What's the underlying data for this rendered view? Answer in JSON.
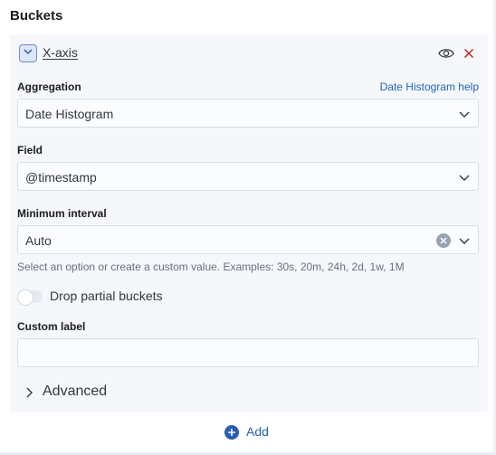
{
  "panel": {
    "title": "Buckets"
  },
  "bucket": {
    "name": "X-axis",
    "aggregation": {
      "label": "Aggregation",
      "help_link": "Date Histogram help",
      "value": "Date Histogram"
    },
    "field": {
      "label": "Field",
      "value": "@timestamp"
    },
    "interval": {
      "label": "Minimum interval",
      "value": "Auto",
      "hint": "Select an option or create a custom value. Examples: 30s, 20m, 24h, 2d, 1w, 1M"
    },
    "drop_partial": {
      "label": "Drop partial buckets",
      "checked": false
    },
    "custom_label": {
      "label": "Custom label",
      "value": ""
    },
    "advanced_label": "Advanced"
  },
  "actions": {
    "add_label": "Add"
  },
  "colors": {
    "link": "#2266bb",
    "accent": "#2a5db0",
    "danger": "#bd271e"
  }
}
